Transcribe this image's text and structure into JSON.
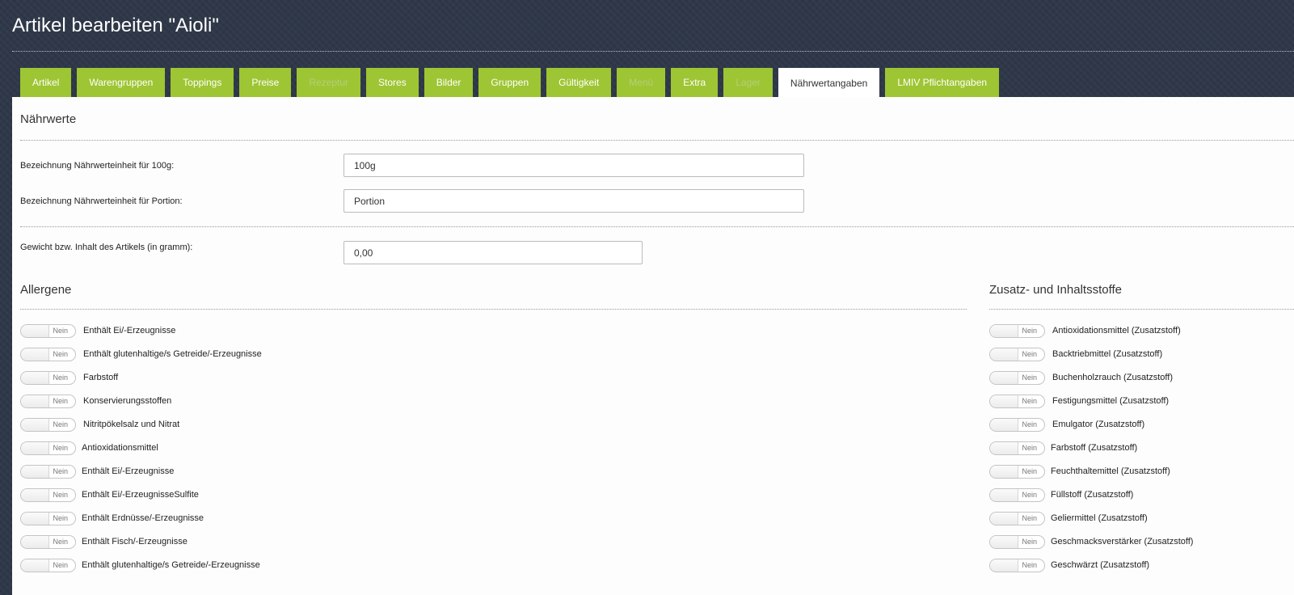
{
  "page": {
    "title": "Artikel bearbeiten \"Aioli\""
  },
  "tabs": [
    {
      "label": "Artikel",
      "state": "enabled"
    },
    {
      "label": "Warengruppen",
      "state": "enabled"
    },
    {
      "label": "Toppings",
      "state": "enabled"
    },
    {
      "label": "Preise",
      "state": "enabled"
    },
    {
      "label": "Rezeptur",
      "state": "disabled"
    },
    {
      "label": "Stores",
      "state": "enabled"
    },
    {
      "label": "Bilder",
      "state": "enabled"
    },
    {
      "label": "Gruppen",
      "state": "enabled"
    },
    {
      "label": "Gültigkeit",
      "state": "enabled"
    },
    {
      "label": "Menü",
      "state": "disabled"
    },
    {
      "label": "Extra",
      "state": "enabled"
    },
    {
      "label": "Lager",
      "state": "disabled"
    },
    {
      "label": "Nährwertangaben",
      "state": "active"
    },
    {
      "label": "LMIV Pflichtangaben",
      "state": "enabled"
    }
  ],
  "naehrwerte": {
    "heading": "Nährwerte",
    "unit_100g": {
      "label": "Bezeichnung Nährwerteinheit für 100g:",
      "value": "100g"
    },
    "unit_portion": {
      "label": "Bezeichnung Nährwerteinheit für Portion:",
      "value": "Portion"
    },
    "weight": {
      "label": "Gewicht bzw. Inhalt des Artikels (in gramm):",
      "value": "0,00"
    }
  },
  "allergene": {
    "heading": "Allergene",
    "items": [
      {
        "label": "Enthält Ei/-Erzeugnisse",
        "state": "Nein"
      },
      {
        "label": "Enthält glutenhaltige/s Getreide/-Erzeugnisse",
        "state": "Nein"
      },
      {
        "label": "Farbstoff",
        "state": "Nein"
      },
      {
        "label": "Konservierungsstoffen",
        "state": "Nein"
      },
      {
        "label": "Nitritpökelsalz und Nitrat",
        "state": "Nein"
      },
      {
        "label": "Antioxidationsmittel",
        "state": "Nein"
      },
      {
        "label": "Enthält Ei/-Erzeugnisse",
        "state": "Nein"
      },
      {
        "label": "Enthält Ei/-ErzeugnisseSulfite",
        "state": "Nein"
      },
      {
        "label": "Enthält Erdnüsse/-Erzeugnisse",
        "state": "Nein"
      },
      {
        "label": "Enthält Fisch/-Erzeugnisse",
        "state": "Nein"
      },
      {
        "label": "Enthält glutenhaltige/s Getreide/-Erzeugnisse",
        "state": "Nein"
      }
    ]
  },
  "zusatzstoffe": {
    "heading": "Zusatz- und Inhaltsstoffe",
    "items": [
      {
        "label": "Antioxidationsmittel (Zusatzstoff)",
        "state": "Nein"
      },
      {
        "label": "Backtriebmittel (Zusatzstoff)",
        "state": "Nein"
      },
      {
        "label": "Buchenholzrauch (Zusatzstoff)",
        "state": "Nein"
      },
      {
        "label": "Festigungsmittel (Zusatzstoff)",
        "state": "Nein"
      },
      {
        "label": "Emulgator (Zusatzstoff)",
        "state": "Nein"
      },
      {
        "label": "Farbstoff (Zusatzstoff)",
        "state": "Nein"
      },
      {
        "label": "Feuchthaltemittel (Zusatzstoff)",
        "state": "Nein"
      },
      {
        "label": "Füllstoff (Zusatzstoff)",
        "state": "Nein"
      },
      {
        "label": "Geliermittel (Zusatzstoff)",
        "state": "Nein"
      },
      {
        "label": "Geschmacksverstärker (Zusatzstoff)",
        "state": "Nein"
      },
      {
        "label": "Geschwärzt (Zusatzstoff)",
        "state": "Nein"
      }
    ]
  },
  "colors": {
    "tab_green": "#9ec533",
    "header_bg": "#2f3849",
    "panel_bg": "#fdfdfd"
  }
}
